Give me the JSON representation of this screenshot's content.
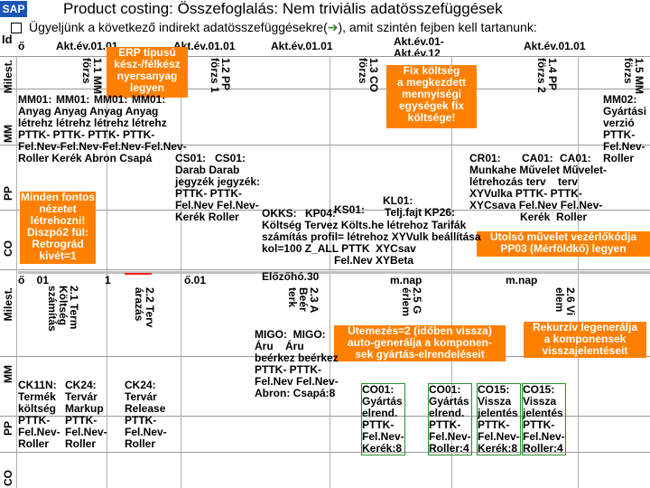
{
  "header": {
    "logo": "SAP",
    "title": "Product costing: Összefoglalás: Nem triviális adatösszefüggések",
    "subtitle": "Ügyeljünk a következő indirekt adatösszefüggésekre(",
    "subtitle_arrow": "➔",
    "subtitle_tail": "), amit szintén fejben kell tartanunk:",
    "id_label": "Id"
  },
  "columns": {
    "c1": "Akt.év.01.01",
    "c2": "Akt.év.01.01",
    "c3": "Akt.év.01.01",
    "c4": "Akt.év.01-\nAkt.év.12",
    "c5": "Akt.év.01.01",
    "o": "ő"
  },
  "milestones_top": {
    "m11": "1.1 MM\nförzs",
    "m12": "1.2 PP\nförzs 1",
    "m13": "1.3 CO\nförzs",
    "m14": "1.4 PP\nförzs 2",
    "m15": "1.5 MM\nförzs"
  },
  "milestones_bottom": {
    "m21": "2.1 Term\nKöltség\nszámítás",
    "m22": "2.2 Terv\nárazás",
    "m23": "2.3 A\nBeér\nterk",
    "m25": "2.5 G\nérlem",
    "m26": "2.6 Vi\nelem"
  },
  "row_labels": {
    "milest_top": "Milest.",
    "mm_top": "MM",
    "pp_top": "PP",
    "co_top": "CO",
    "milest_bottom": "Milest.",
    "mm_bottom": "MM",
    "pp_bottom": "PP",
    "co_bottom": "CO"
  },
  "callouts": {
    "erp": "ERP típusú\nkész-/félkész\nnyersanyag\nlegyen",
    "fix": "Fix költség\na megkezdett\nmennyiségi\negységek fix\nköltsége!",
    "minden": "Minden fontos\nnézetet\nlétrehozni!\nDiszpó2 fül:\nRetrográd\nkivét=1",
    "utolso": "Utolsó művelet vezérlőkódja\nPP03 (Mérföldkő) legyen",
    "utemezes": "Ütemezés=2 (időben vissza)\nauto-generálja a komponen-\nsek gyártás-elrendeléseit",
    "rekurziv": "Rekurzív legenerálja\na komponensek\nvisszajelentéseit"
  },
  "mm_top_cells": {
    "mm01a": "MM01:",
    "mm01b": "MM01:",
    "mm01c": "MM01:",
    "mm01d": "MM01:",
    "anyag": "Anyag Anyag Anyag Anyag",
    "letrehoz": "létrehz létrehz létrehz létrehz",
    "pttk": "PTTK- PTTK- PTTK- PTTK-",
    "felnev": "Fel.Nev-Fel.Nev-Fel.Nev-Fel.Nev-",
    "roller": "Roller Kerék Abron Csapá",
    "mm02": "MM02:\nGyártási\nverzió\nPTTK-\nFel.Nev-\nRoller"
  },
  "pp_top_cells": {
    "cs01a": "CS01:",
    "cs01b": "CS01:",
    "darab": "Darab Darab\njegyzék jegyzék:\nPTTK- PTTK-\nFel.Nev Fel.Nev-\nKerék Roller",
    "okks": "OKKS:",
    "kp04": "KP04:",
    "ks01": "KS01:",
    "kl01": "KL01:",
    "telj": "Telj.fajt",
    "kp26": "KP26:",
    "koltseg": "Költség Tervez Költs.he létrehoz Tarifák",
    "szamitas": "számítás profil= létrehoz XYVulk beállítása",
    "kol100": "kol=100 Z_ALL PTTK  XYCsav",
    "felnev": "Fel.Nev XYBeta",
    "cr01": "CR01:",
    "ca01a": "CA01:",
    "ca01b": "CA01:",
    "munkahe": "Munkahe Művelet Művelet-",
    "letrehozasa": "létrehozás terv    terv",
    "xyvulka": "XYVulka PTTK- PTTK-",
    "xycsava": "XYCsava Fel.Nev Fel.Nev-",
    "kerek": "Kerék  Roller"
  },
  "date_row": {
    "d1": "ő    01",
    "d2": "1",
    "d3": "ő.01",
    "d4": "Előzőhó.30",
    "d5": "m.nap",
    "d6": "m.nap"
  },
  "mm_bottom_cells": {
    "ck11n": "CK11N:\nTermék\nköltség\nPTTK-\nFel.Nev-\nRoller",
    "ck24a": "CK24:\nTervár\nMarkup\nPTTK-\nFel.Nev-\nRoller",
    "ck24b": "CK24:\nTervár\nRelease\nPTTK-\nFel.Nev-\nRoller",
    "migo": "MIGO:  MIGO:\nÁru    Áru\nbeérkez beérkez\nPTTK- PTTK-\nFel.Nev Fel.Nev-\nAbron: Csapá:8",
    "co01a": "CO01:\nGyártás\nelrend.\nPTTK-\nFel.Nev-\nKerék:8",
    "co01b": "CO01:\nGyártás\nelrend.\nPTTK-\nFel.Nev-\nRoller:4",
    "co15a": "CO15:\nVissza\njelentés\nPTTK-\nFel.Nev-\nKerék:8",
    "co15b": "CO15:\nVissza\njelentés\nPTTK-\nFel.Nev-\nRoller:4"
  },
  "colors": {
    "orange": "#ff8000",
    "red": "#ff2020",
    "green": "#2e8b2e",
    "sap_blue": "#1a56b8"
  }
}
